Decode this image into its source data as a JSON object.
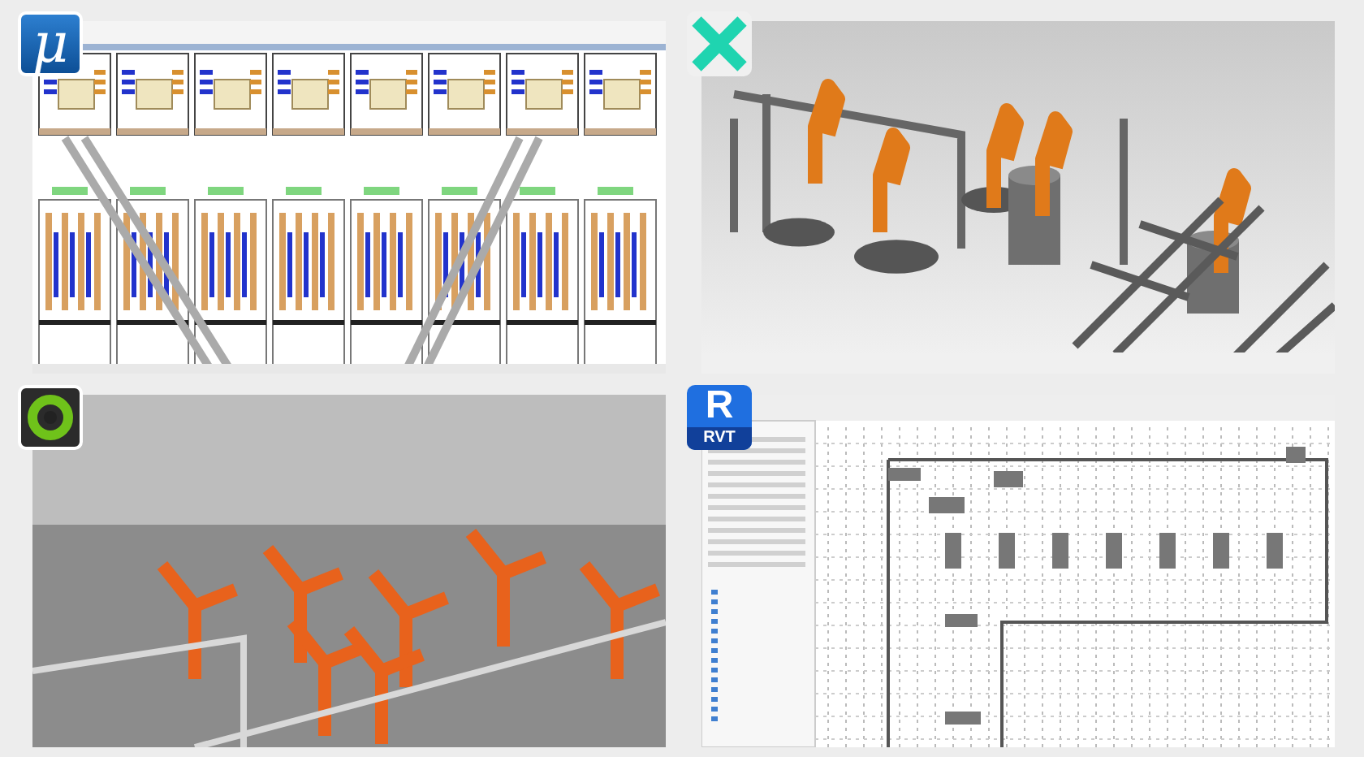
{
  "tiles": [
    {
      "kind": "cad",
      "logo": {
        "kind": "mu",
        "letter": "μ"
      }
    },
    {
      "kind": "view3d",
      "logo": {
        "kind": "cross"
      }
    },
    {
      "kind": "photo",
      "logo": {
        "kind": "ring"
      }
    },
    {
      "kind": "plan",
      "logo": {
        "kind": "rvt",
        "letter": "R",
        "caption": "RVT"
      }
    }
  ]
}
